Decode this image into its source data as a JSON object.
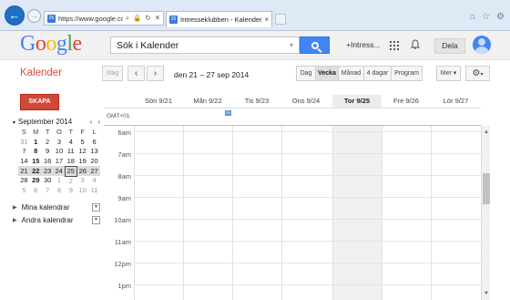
{
  "browser": {
    "url": "https://www.google.co...",
    "tab_title": "Intresseklubben - Kalender",
    "back_glyph": "←",
    "forward_glyph": "→",
    "favicon_text": "25"
  },
  "google_bar": {
    "search_value": "Sök i Kalender",
    "plus_link": "+Intress...",
    "share_label": "Dela"
  },
  "calendar": {
    "app_title": "Kalender",
    "today_button": "Idag",
    "date_range": "den 21 – 27 sep 2014",
    "views": [
      "Dag",
      "Vecka",
      "Månad",
      "4 dagar",
      "Program"
    ],
    "active_view": "Vecka",
    "more_button": "Mer",
    "create_button": "SKAPA"
  },
  "mini_calendar": {
    "month_label": "September 2014",
    "weekdays": [
      "S",
      "M",
      "T",
      "O",
      "T",
      "F",
      "L"
    ],
    "weeks": [
      [
        "31",
        "1",
        "2",
        "3",
        "4",
        "5",
        "6"
      ],
      [
        "7",
        "8",
        "9",
        "10",
        "11",
        "12",
        "13"
      ],
      [
        "14",
        "15",
        "16",
        "17",
        "18",
        "19",
        "20"
      ],
      [
        "21",
        "22",
        "23",
        "24",
        "25",
        "26",
        "27"
      ],
      [
        "28",
        "29",
        "30",
        "1",
        "2",
        "3",
        "4"
      ],
      [
        "5",
        "6",
        "7",
        "8",
        "9",
        "10",
        "11"
      ]
    ],
    "today": "25"
  },
  "calendar_lists": {
    "mine": "Mina kalendrar",
    "other": "Andra kalendrar"
  },
  "week_view": {
    "timezone": "GMT+01",
    "days": [
      "Sön 9/21",
      "Mån 9/22",
      "Tis 9/23",
      "Ons 9/24",
      "Tor 9/25",
      "Fre 9/26",
      "Lör 9/27"
    ],
    "today_index": 4,
    "hours": [
      "6am",
      "7am",
      "8am",
      "9am",
      "10am",
      "11am",
      "12pm",
      "1pm"
    ],
    "allday_chip_text": "29"
  },
  "colors": {
    "accent_red": "#dd4b39",
    "create_button": "#d14836",
    "search_blue": "#4285f4"
  }
}
